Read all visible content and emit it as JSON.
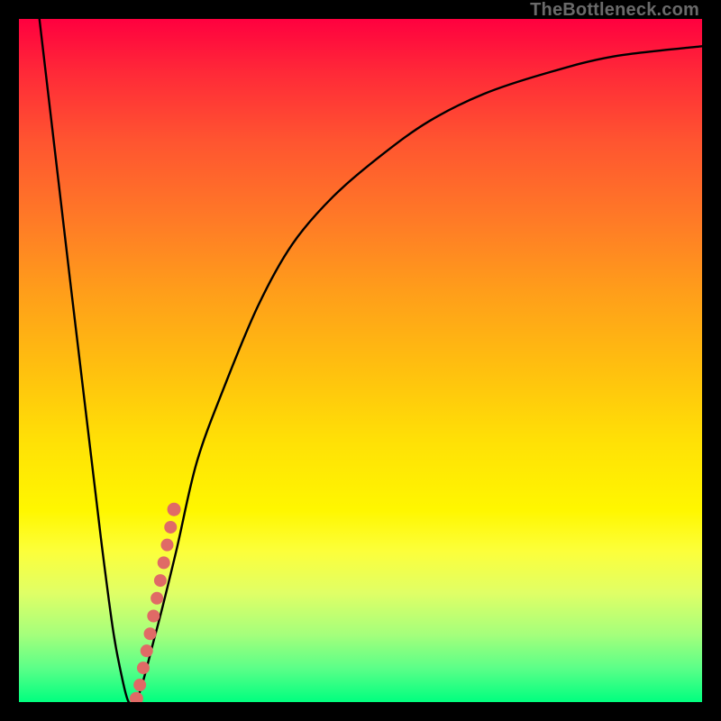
{
  "watermark": "TheBottleneck.com",
  "colors": {
    "frame": "#000000",
    "curve": "#000000",
    "dot": "#e06a66"
  },
  "chart_data": {
    "type": "line",
    "title": "",
    "xlabel": "",
    "ylabel": "",
    "xlim": [
      0,
      100
    ],
    "ylim": [
      0,
      100
    ],
    "series": [
      {
        "name": "bottleneck-curve",
        "x_pct": [
          3,
          12,
          15,
          17,
          20,
          23,
          26,
          30,
          35,
          40,
          46,
          53,
          60,
          68,
          77,
          87,
          100
        ],
        "y_pct": [
          100,
          24,
          4,
          0,
          10,
          22,
          35,
          46,
          58,
          67,
          74,
          80,
          85,
          89,
          92,
          94.5,
          96
        ]
      }
    ],
    "markers": {
      "name": "highlight-dots",
      "x_pct": [
        17.2,
        17.7,
        18.2,
        18.7,
        19.2,
        19.7,
        20.2,
        20.7,
        21.2,
        21.7,
        22.2,
        22.7
      ],
      "y_pct": [
        0.5,
        2.5,
        5.0,
        7.5,
        10.0,
        12.6,
        15.2,
        17.8,
        20.4,
        23.0,
        25.6,
        28.2
      ]
    }
  }
}
